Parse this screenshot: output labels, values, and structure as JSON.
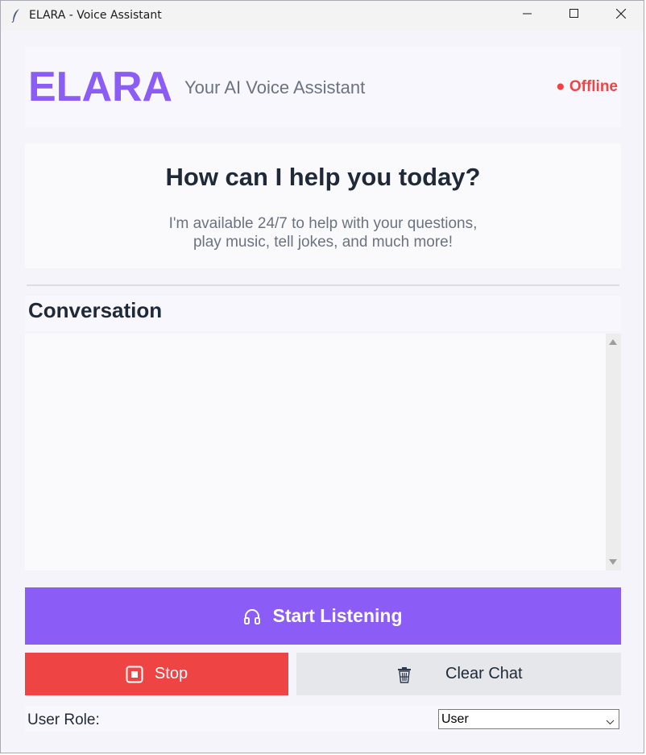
{
  "window": {
    "title": "ELARA - Voice Assistant",
    "icons": [
      "feather-icon",
      "minimize-icon",
      "maximize-icon",
      "close-icon"
    ]
  },
  "header": {
    "brand": "ELARA",
    "tagline": "Your AI Voice Assistant",
    "status": "● Offline"
  },
  "welcome": {
    "heading": "How can I help you today?",
    "line1": "I'm available 24/7 to help with your questions,",
    "line2": "play music, tell jokes, and much more!"
  },
  "conversation": {
    "title": "Conversation",
    "messages": []
  },
  "controls": {
    "listen_label": "Start Listening",
    "listen_icon": "headphones-icon",
    "stop_label": "Stop",
    "stop_icon": "stop-icon",
    "clear_label": "Clear Chat",
    "clear_icon": "trash-icon"
  },
  "footer": {
    "role_label": "User Role:",
    "role_value": "User"
  },
  "colors": {
    "accent": "#8b5cf6",
    "danger": "#ef4444",
    "neutral_button": "#e5e7eb",
    "text_dark": "#1f2937",
    "text_muted": "#6b7280"
  }
}
